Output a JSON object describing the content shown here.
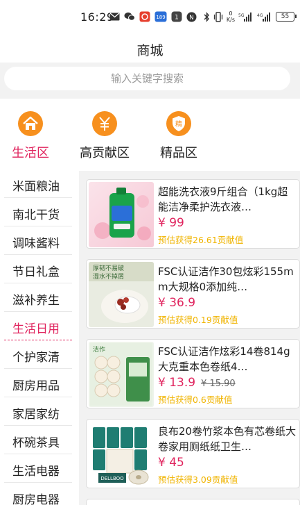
{
  "status_bar": {
    "time": "16:29",
    "net_speed_top": "0",
    "net_speed_unit": "K/s",
    "battery": "55"
  },
  "header": {
    "title": "商城"
  },
  "search": {
    "placeholder": "输入关键字搜索"
  },
  "zones": [
    {
      "label": "生活区",
      "icon": "home-icon",
      "active": true
    },
    {
      "label": "高贡献区",
      "icon": "yuan-icon",
      "active": false
    },
    {
      "label": "精品区",
      "icon": "shield-icon",
      "glyph": "精",
      "active": false
    }
  ],
  "colors": {
    "accent": "#e0245e",
    "zone_icon": "#f7901e",
    "reward": "#f0b400"
  },
  "categories": [
    {
      "label": "米面粮油"
    },
    {
      "label": "南北干货"
    },
    {
      "label": "调味酱料"
    },
    {
      "label": "节日礼盒"
    },
    {
      "label": "滋补养生"
    },
    {
      "label": "生活日用",
      "active": true
    },
    {
      "label": "个护家清"
    },
    {
      "label": "厨房用品"
    },
    {
      "label": "家居家纺"
    },
    {
      "label": "杯碗茶具"
    },
    {
      "label": "生活电器"
    },
    {
      "label": "厨房电器"
    }
  ],
  "products": [
    {
      "name": "超能洗衣液9斤组合（1kg超能洁净柔护洗衣液…",
      "price": "¥ 99",
      "old_price": "",
      "reward": "预估获得26.61贡献值",
      "image": "laundry-detergent-image"
    },
    {
      "name": "FSC认证洁作30包炫彩155mm大规格0添加纯…",
      "price": "¥ 36.9",
      "old_price": "",
      "reward": "预估获得0.19贡献值",
      "image": "tissue-pack-image",
      "image_text": [
        "厚韧不易破",
        "湿水不掉屑"
      ]
    },
    {
      "name": "FSC认证洁作炫彩14卷814g大克重本色卷纸4…",
      "price": "¥ 13.9",
      "old_price": "¥ 15.90",
      "reward": "预估获得0.6贡献值",
      "image": "toilet-roll-image",
      "image_text": [
        "洁作"
      ]
    },
    {
      "name": "良布20卷竹浆本色有芯卷纸大卷家用厕纸纸卫生…",
      "price": "¥ 45",
      "old_price": "",
      "reward": "预估获得3.09贡献值",
      "image": "bamboo-roll-image",
      "image_text": [
        "DELLBOO"
      ]
    }
  ]
}
